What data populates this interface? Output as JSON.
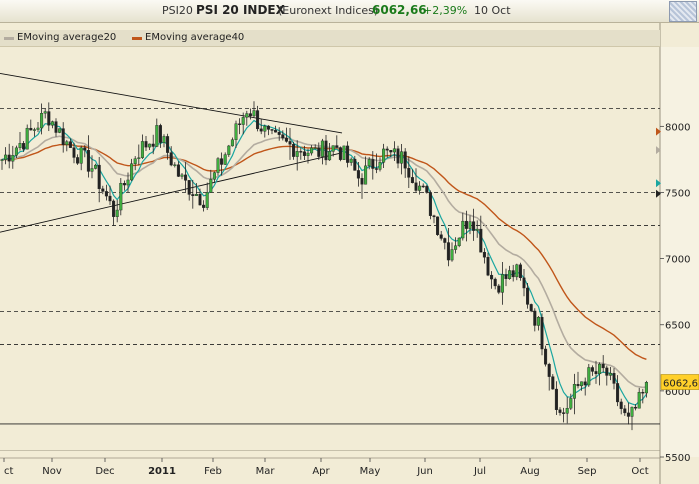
{
  "header": {
    "symbol": "PSI20",
    "name": "PSI 20 INDEX",
    "exchange": "(Euronext Indices)",
    "last_price": "6062,66",
    "change": "+2,39%",
    "date": "10 Oct"
  },
  "colors": {
    "background": "#f2ecd6",
    "up_candle": "#3fae3f",
    "down_candle": "#222222",
    "ema20": "#b3aca0",
    "ema40": "#c0561a",
    "tenkan": "#1aa6a0",
    "price_tag": "#ffd02a"
  },
  "chart_data": {
    "type": "candlestick",
    "title": "PSI 20 INDEX",
    "x_tick_labels": [
      "ct",
      "Nov",
      "Dec",
      "2011",
      "Feb",
      "Mar",
      "Apr",
      "May",
      "Jun",
      "Jul",
      "Aug",
      "Sep",
      "Oct"
    ],
    "y_tick_labels": [
      "8000",
      "7500",
      "7000",
      "6500",
      "6000",
      "5500"
    ],
    "ylim": [
      5500,
      8600
    ],
    "last_value_label": "6062,6",
    "grid": false,
    "legend_placement": "top-left",
    "series": [
      {
        "name": "EMoving average20",
        "color": "#b3aca0"
      },
      {
        "name": "EMoving average40",
        "color": "#c0561a"
      }
    ],
    "anchors": [
      {
        "month": "Oct",
        "close": 7750
      },
      {
        "month": "Oct",
        "close": 7900
      },
      {
        "month": "Nov",
        "close": 8100
      },
      {
        "month": "Nov",
        "close": 7850
      },
      {
        "month": "Nov",
        "close": 7700
      },
      {
        "month": "Dec",
        "close": 7350
      },
      {
        "month": "Dec",
        "close": 7800
      },
      {
        "month": "Dec",
        "close": 7950
      },
      {
        "month": "Dec",
        "close": 7600
      },
      {
        "month": "2011",
        "close": 7450
      },
      {
        "month": "2011",
        "close": 7800
      },
      {
        "month": "Feb",
        "close": 8150
      },
      {
        "month": "Feb",
        "close": 7900
      },
      {
        "month": "Mar",
        "close": 7850
      },
      {
        "month": "Mar",
        "close": 7800
      },
      {
        "month": "Apr",
        "close": 7850
      },
      {
        "month": "Apr",
        "close": 7600
      },
      {
        "month": "May",
        "close": 7800
      },
      {
        "month": "May",
        "close": 7750
      },
      {
        "month": "Jun",
        "close": 7450
      },
      {
        "month": "Jun",
        "close": 7050
      },
      {
        "month": "Jul",
        "close": 7350
      },
      {
        "month": "Jul",
        "close": 6800
      },
      {
        "month": "Jul",
        "close": 6900
      },
      {
        "month": "Aug",
        "close": 6500
      },
      {
        "month": "Aug",
        "close": 5800
      },
      {
        "month": "Aug",
        "close": 6100
      },
      {
        "month": "Sep",
        "close": 6150
      },
      {
        "month": "Sep",
        "close": 5750
      },
      {
        "month": "Oct",
        "close": 6063
      }
    ]
  }
}
